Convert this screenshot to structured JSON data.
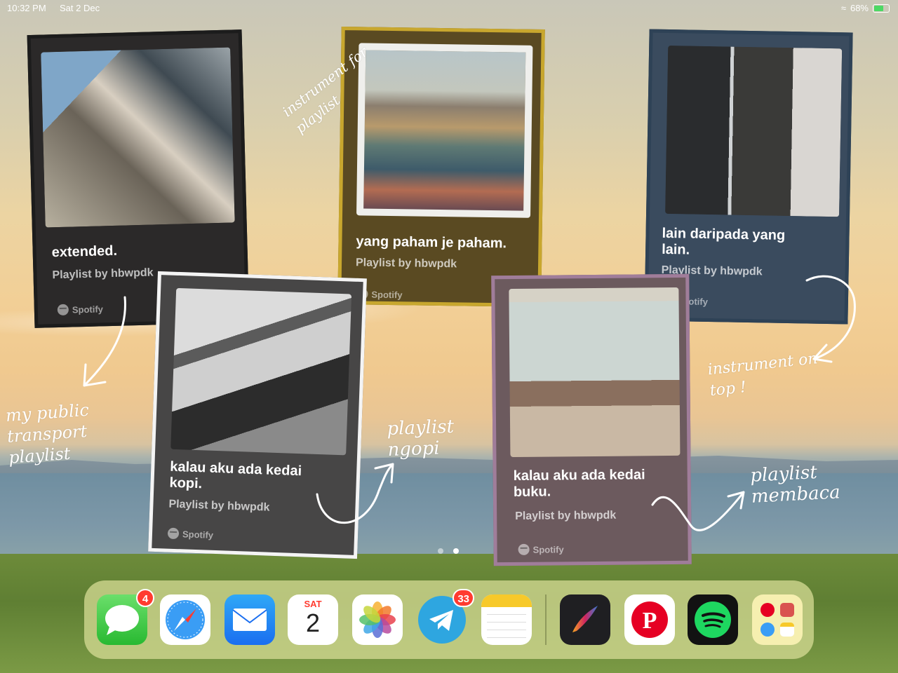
{
  "status": {
    "time": "10:32 PM",
    "date": "Sat 2 Dec",
    "battery": "68%"
  },
  "widgets": [
    {
      "title": "extended.",
      "subtitle": "Playlist by hbwpdk",
      "brand": "Spotify"
    },
    {
      "title": "yang paham je paham.",
      "subtitle": "Playlist by hbwpdk",
      "brand": "Spotify"
    },
    {
      "title": "lain daripada yang lain.",
      "subtitle": "Playlist by hbwpdk",
      "brand": "Spotify"
    },
    {
      "title": "kalau aku ada kedai kopi.",
      "subtitle": "Playlist by hbwpdk",
      "brand": "Spotify"
    },
    {
      "title": "kalau aku ada kedai buku.",
      "subtitle": "Playlist by hbwpdk",
      "brand": "Spotify"
    }
  ],
  "notes": {
    "n1": "my public transport playlist",
    "n2": "instrument for playlist",
    "n3": "instrument on top !",
    "n4": "playlist ngopi",
    "n5": "playlist membaca"
  },
  "dock": {
    "messages_badge": "4",
    "calendar_day": "SAT",
    "calendar_date": "2",
    "telegram_badge": "33"
  },
  "colors": {
    "card1": "#2b2929",
    "card2": "#5a4a22",
    "card3": "#3a4b5e",
    "card4": "#474646",
    "card5": "#6c5a5e"
  }
}
